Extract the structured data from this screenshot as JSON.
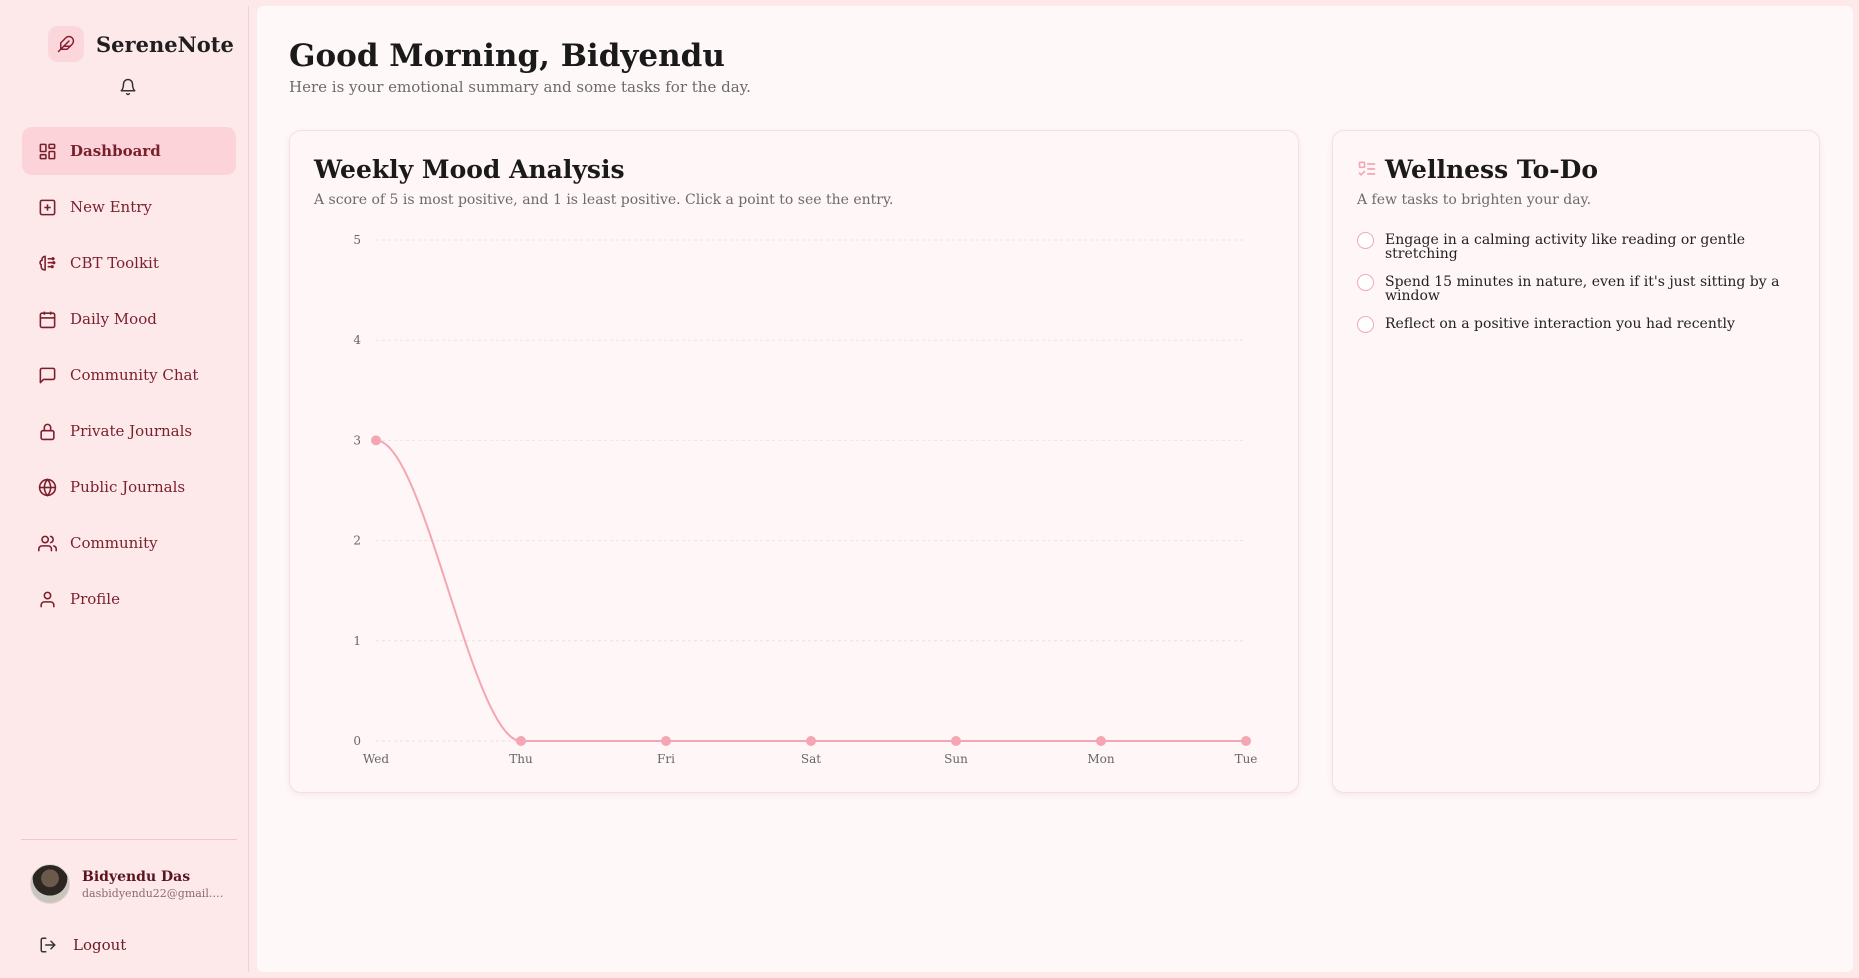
{
  "app": {
    "name": "SereneNote"
  },
  "sidebar": {
    "items": [
      {
        "label": "Dashboard",
        "icon": "dashboard-icon",
        "active": true
      },
      {
        "label": "New Entry",
        "icon": "plus-square-icon"
      },
      {
        "label": "CBT Toolkit",
        "icon": "brain-icon"
      },
      {
        "label": "Daily Mood",
        "icon": "calendar-icon"
      },
      {
        "label": "Community Chat",
        "icon": "chat-icon"
      },
      {
        "label": "Private Journals",
        "icon": "lock-icon"
      },
      {
        "label": "Public Journals",
        "icon": "globe-icon"
      },
      {
        "label": "Community",
        "icon": "users-icon"
      },
      {
        "label": "Profile",
        "icon": "user-icon"
      }
    ],
    "user": {
      "name": "Bidyendu Das",
      "email": "dasbidyendu22@gmail.com"
    },
    "logout_label": "Logout"
  },
  "header": {
    "greeting": "Good Morning, Bidyendu",
    "subtitle": "Here is your emotional summary and some tasks for the day."
  },
  "mood_card": {
    "title": "Weekly Mood Analysis",
    "subtitle": "A score of 5 is most positive, and 1 is least positive. Click a point to see the entry."
  },
  "todo_card": {
    "title": "Wellness To-Do",
    "subtitle": "A few tasks to brighten your day.",
    "tasks": [
      "Engage in a calming activity like reading or gentle stretching",
      "Spend 15 minutes in nature, even if it's just sitting by a window",
      "Reflect on a positive interaction you had recently"
    ]
  },
  "colors": {
    "accent": "#f4a6b2",
    "nav_text": "#7a1f2c",
    "active_bg": "#fbd3d9"
  },
  "chart_data": {
    "type": "line",
    "categories": [
      "Wed",
      "Thu",
      "Fri",
      "Sat",
      "Sun",
      "Mon",
      "Tue"
    ],
    "values": [
      3,
      0,
      0,
      0,
      0,
      0,
      0
    ],
    "ylim": [
      0,
      5
    ],
    "yticks": [
      0,
      1,
      2,
      3,
      4,
      5
    ],
    "grid": true
  }
}
